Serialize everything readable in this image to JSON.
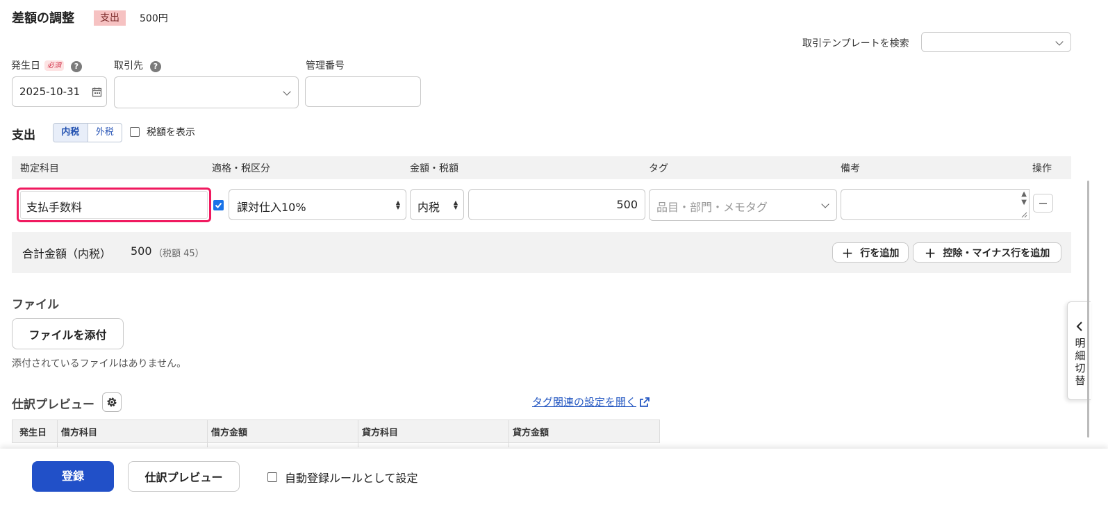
{
  "header": {
    "title": "差額の調整",
    "type_badge": "支出",
    "amount": "500円",
    "template_search_label": "取引テンプレートを検索",
    "template_search_value": ""
  },
  "form": {
    "date_label": "発生日",
    "required_badge": "必須",
    "date_value": "2025-10-31",
    "partner_label": "取引先",
    "partner_value": "",
    "mgmt_no_label": "管理番号",
    "mgmt_no_value": ""
  },
  "expense": {
    "section_title": "支出",
    "tax_mode_options": [
      "内税",
      "外税"
    ],
    "tax_mode_selected": "内税",
    "show_tax_label": "税額を表示",
    "show_tax_checked": false,
    "columns": [
      "勘定科目",
      "適格・税区分",
      "金額・税額",
      "タグ",
      "備考",
      "操作"
    ],
    "rows": [
      {
        "account": "支払手数料",
        "qualified_checked": true,
        "tax_category": "課対仕入10%",
        "tax_type": "内税",
        "amount": "500",
        "tag_placeholder": "品目・部門・メモタグ",
        "note": ""
      }
    ],
    "total_label": "合計金額（内税）",
    "total_amount": "500",
    "total_tax": "（税額 45）",
    "add_row_label": "行を追加",
    "add_deduction_row_label": "控除・マイナス行を追加"
  },
  "file": {
    "section_title": "ファイル",
    "attach_button": "ファイルを添付",
    "empty_message": "添付されているファイルはありません。"
  },
  "preview": {
    "section_title": "仕訳プレビュー",
    "tag_settings_link": "タグ関連の設定を開く",
    "columns": [
      "発生日",
      "借方科目",
      "借方金額",
      "貸方科目",
      "貸方金額"
    ]
  },
  "footer": {
    "register_button": "登録",
    "preview_button": "仕訳プレビュー",
    "auto_rule_label": "自動登録ルールとして設定",
    "auto_rule_checked": false
  },
  "side_tab": {
    "label": "明細切替"
  },
  "colors": {
    "primary": "#2150C8",
    "highlight": "#F0195F",
    "expense_badge_bg": "#F6C2C2"
  }
}
